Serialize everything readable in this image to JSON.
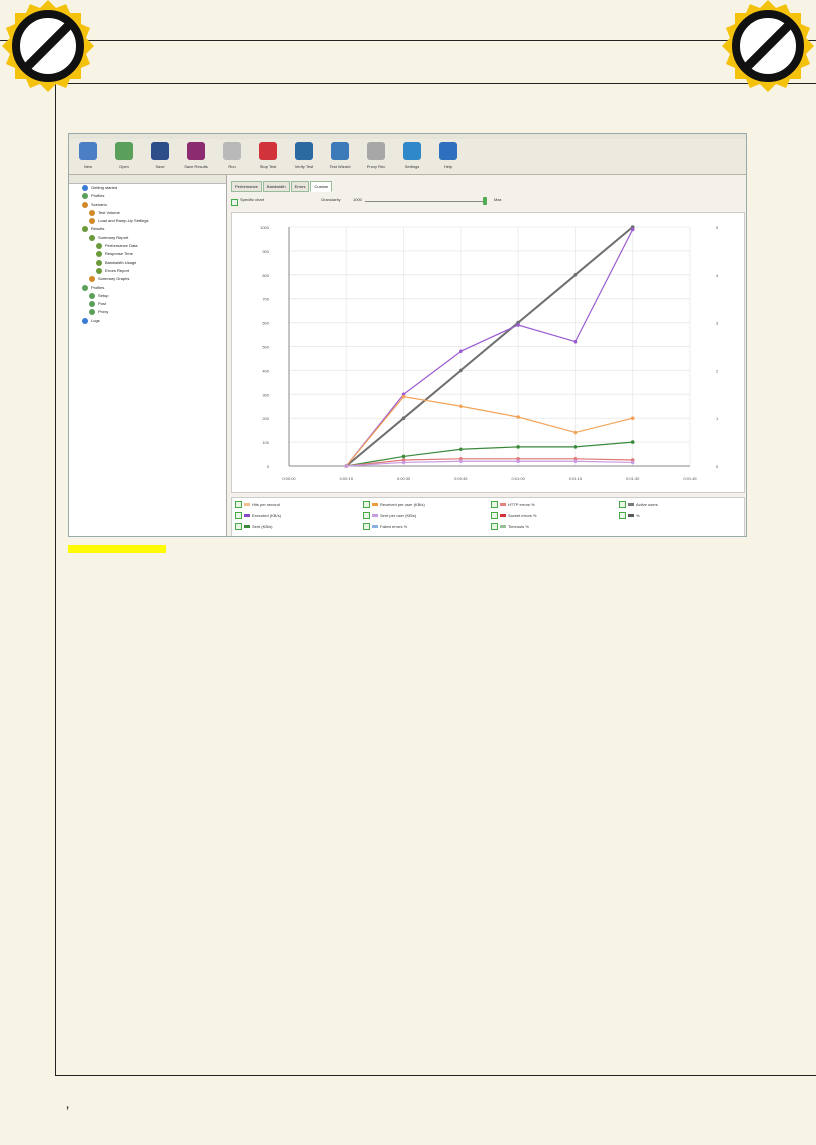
{
  "toolbar": {
    "buttons": [
      {
        "label": "New",
        "icon": "new-file-icon",
        "color": "#4a7fc6"
      },
      {
        "label": "Open",
        "icon": "open-folder-icon",
        "color": "#5aa05a"
      },
      {
        "label": "Save",
        "icon": "save-icon",
        "color": "#2c4f8a"
      },
      {
        "label": "Save Results",
        "icon": "save-results-icon",
        "color": "#8a2c6f"
      },
      {
        "label": "Run",
        "icon": "run-icon",
        "color": "#b9b9b9"
      },
      {
        "label": "Stop Test",
        "icon": "stop-icon",
        "color": "#d0343a"
      },
      {
        "label": "Verify Test",
        "icon": "verify-icon",
        "color": "#2a6aa0"
      },
      {
        "label": "Test Wizard",
        "icon": "wizard-icon",
        "color": "#3c7ab8"
      },
      {
        "label": "Proxy Rec",
        "icon": "proxy-icon",
        "color": "#a7a7a7"
      },
      {
        "label": "Settings",
        "icon": "settings-icon",
        "color": "#2f88c8"
      },
      {
        "label": "Help",
        "icon": "help-icon",
        "color": "#2f6fc0"
      }
    ]
  },
  "tree": {
    "items": [
      {
        "label": "Getting started",
        "indent": 1,
        "color": "#3a7bd5"
      },
      {
        "label": "Profiles",
        "indent": 1,
        "color": "#5aa05a"
      },
      {
        "label": "Scenario",
        "indent": 1,
        "color": "#d08a2a"
      },
      {
        "label": "Test Volume",
        "indent": 2,
        "color": "#d08a2a"
      },
      {
        "label": "Load and Ramp-Up Settings",
        "indent": 2,
        "color": "#d08a2a"
      },
      {
        "label": "Results",
        "indent": 1,
        "color": "#6a9a3a"
      },
      {
        "label": "Summary Report",
        "indent": 2,
        "color": "#6a9a3a"
      },
      {
        "label": "Performance Data",
        "indent": 3,
        "color": "#6a9a3a"
      },
      {
        "label": "Response Time",
        "indent": 3,
        "color": "#6a9a3a"
      },
      {
        "label": "Bandwidth Usage",
        "indent": 3,
        "color": "#6a9a3a"
      },
      {
        "label": "Errors Report",
        "indent": 3,
        "color": "#6a9a3a"
      },
      {
        "label": "Summary Graphs",
        "indent": 2,
        "color": "#d08a2a"
      },
      {
        "label": "Profiles",
        "indent": 1,
        "color": "#5aa05a"
      },
      {
        "label": "Setup",
        "indent": 2,
        "color": "#5aa05a"
      },
      {
        "label": "Post",
        "indent": 2,
        "color": "#5aa05a"
      },
      {
        "label": "Proxy",
        "indent": 2,
        "color": "#5aa05a"
      },
      {
        "label": "Logs",
        "indent": 1,
        "color": "#3a7bd5"
      }
    ]
  },
  "tabs": [
    "Performance",
    "Bandwidth",
    "Errors",
    "Custom"
  ],
  "active_tab": "Custom",
  "controls": {
    "checkbox_label": "Specific chart",
    "granularity_label": "Granularity",
    "granularity_value": "1000",
    "granularity_unit": "Max"
  },
  "legend": [
    {
      "label": "Hits per second",
      "color": "#f3c08a"
    },
    {
      "label": "Received per user (KB/s)",
      "color": "#f39a3a"
    },
    {
      "label": "HTTP errors %",
      "color": "#e98080"
    },
    {
      "label": "Active users",
      "color": "#7a7a7a"
    },
    {
      "label": "Executed (KB/s)",
      "color": "#8a48c8"
    },
    {
      "label": "Sent per user (KB/s)",
      "color": "#c89ae0"
    },
    {
      "label": "Socket errors %",
      "color": "#d0343a"
    },
    {
      "label": "%",
      "color": "#5a5a5a"
    },
    {
      "label": "Sent (KB/s)",
      "color": "#3a8a3a"
    },
    {
      "label": "Failed errors %",
      "color": "#8ab0e0"
    },
    {
      "label": "Timeouts %",
      "color": "#9ac09a"
    }
  ],
  "chart_data": {
    "type": "line",
    "x": [
      "0:00:00",
      "0:00:15",
      "0:00:30",
      "0:00:45",
      "0:01:00",
      "0:01:15",
      "0:01:30",
      "0:01:45"
    ],
    "ylim": [
      0,
      1000
    ],
    "y2lim": [
      0,
      5
    ],
    "series": [
      {
        "name": "Active users",
        "color": "#6e6e6e",
        "values": [
          null,
          0,
          200,
          400,
          600,
          800,
          1000,
          null
        ]
      },
      {
        "name": "Executed (KB/s)",
        "color": "#9a5ad0",
        "values": [
          null,
          0,
          300,
          480,
          590,
          520,
          990,
          null
        ]
      },
      {
        "name": "Received per user (KB/s)",
        "color": "#f3a358",
        "values": [
          null,
          0,
          290,
          250,
          205,
          140,
          200,
          null
        ]
      },
      {
        "name": "Sent (KB/s)",
        "color": "#3a8a3a",
        "values": [
          null,
          0,
          40,
          70,
          80,
          80,
          100,
          null
        ]
      },
      {
        "name": "HTTP errors %",
        "color": "#e07575",
        "values": [
          null,
          0,
          25,
          30,
          30,
          30,
          25,
          null
        ]
      },
      {
        "name": "Sent per user (KB/s)",
        "color": "#c89ae0",
        "values": [
          null,
          0,
          15,
          20,
          20,
          20,
          15,
          null
        ]
      }
    ]
  }
}
